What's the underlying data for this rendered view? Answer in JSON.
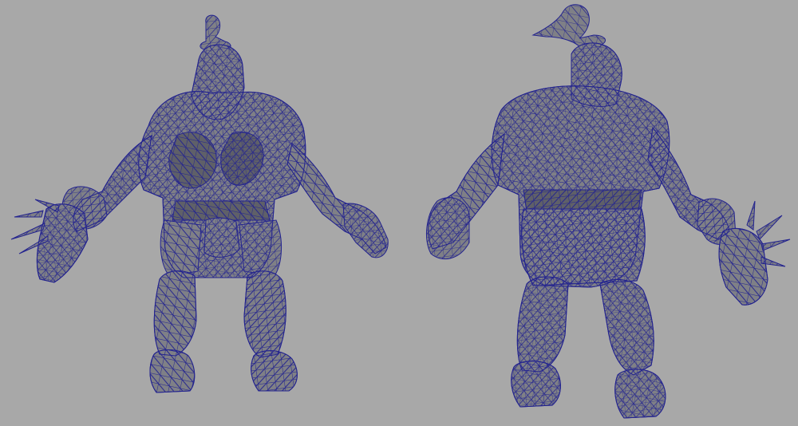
{
  "viewport": {
    "background": "#a8a8a8",
    "mesh_fill": "#7f8086",
    "mesh_shadow": "#5f6068",
    "mesh_highlight": "#9a9ba2",
    "wire_color": "#23238f",
    "views": [
      {
        "id": "front",
        "subject": "character-mesh-front-view"
      },
      {
        "id": "back",
        "subject": "character-mesh-back-view"
      }
    ]
  }
}
